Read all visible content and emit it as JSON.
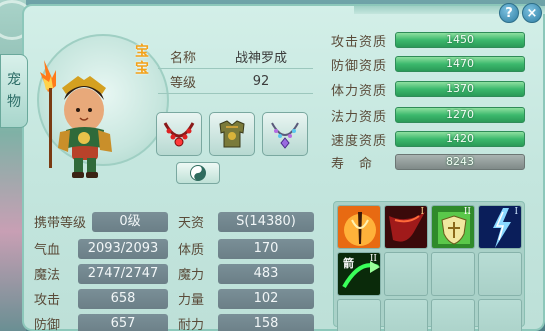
{
  "side_tab": {
    "chars": [
      "宠",
      "物"
    ]
  },
  "window": {
    "help_label": "?",
    "close_label": "×"
  },
  "pet": {
    "badge": "宝宝",
    "name_label": "名称",
    "name": "战神罗成",
    "level_label": "等级",
    "level": "92"
  },
  "equipment": [
    {
      "icon": "ruby-necklace-icon"
    },
    {
      "icon": "golden-armor-icon"
    },
    {
      "icon": "gem-necklace-icon"
    }
  ],
  "aptitudes": [
    {
      "label": "攻击资质",
      "value": "1450"
    },
    {
      "label": "防御资质",
      "value": "1470"
    },
    {
      "label": "体力资质",
      "value": "1370"
    },
    {
      "label": "法力资质",
      "value": "1270"
    },
    {
      "label": "速度资质",
      "value": "1420"
    },
    {
      "label": "寿　命",
      "value": "8243"
    }
  ],
  "attributes": [
    {
      "label": "携带等级",
      "value": "0级",
      "label2": "天资",
      "value2": "S(14380)"
    },
    {
      "label": "气血",
      "value": "2093/2093",
      "label2": "体质",
      "value2": "170"
    },
    {
      "label": "魔法",
      "value": "2747/2747",
      "label2": "魔力",
      "value2": "483"
    },
    {
      "label": "攻击",
      "value": "658",
      "label2": "力量",
      "value2": "102"
    },
    {
      "label": "防御",
      "value": "657",
      "label2": "耐力",
      "value2": "158"
    }
  ],
  "skills": [
    {
      "icon": "sword-slash-skill-icon",
      "tier": ""
    },
    {
      "icon": "dark-bird-skill-icon",
      "tier": "I"
    },
    {
      "icon": "shield-buff-skill-icon",
      "tier": "II"
    },
    {
      "icon": "lightning-skill-icon",
      "tier": "I"
    },
    {
      "icon": "green-arrow-skill-icon",
      "tier": "II",
      "label": "箭"
    }
  ]
}
